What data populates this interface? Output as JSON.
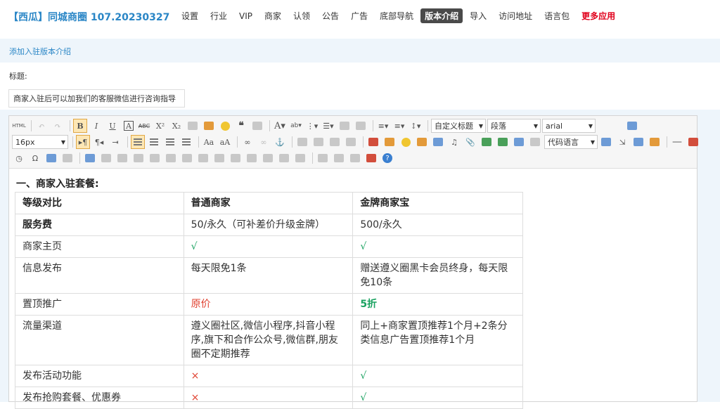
{
  "app": {
    "brand": "【西瓜】同城商圈 107.20230327"
  },
  "nav": {
    "items": [
      "设置",
      "行业",
      "VIP",
      "商家",
      "认领",
      "公告",
      "广告",
      "底部导航"
    ],
    "active": "版本介绍",
    "after": [
      "导入",
      "访问地址",
      "语言包"
    ],
    "more": "更多应用"
  },
  "section": {
    "title": "添加入驻版本介绍"
  },
  "form": {
    "title_label": "标题:",
    "title_value": "商家入驻后可以加我们的客服微信进行咨询指导"
  },
  "toolbar": {
    "custom_title": "自定义标题",
    "paragraph": "段落",
    "font": "arial",
    "font_size": "16px",
    "code_lang": "代码语言"
  },
  "content": {
    "heading": "一、商家入驻套餐:",
    "table": {
      "headers": [
        "等级对比",
        "普通商家",
        "金牌商家宝"
      ],
      "rows": [
        [
          "服务费",
          "50/永久（可补差价升级金牌）",
          "500/永久"
        ],
        [
          "商家主页",
          "√",
          "√"
        ],
        [
          "信息发布",
          "每天限免1条",
          "赠送遵义圈黑卡会员终身，每天限免10条"
        ],
        [
          "置顶推广",
          "原价",
          "5折"
        ],
        [
          "流量渠道",
          "遵义圈社区,微信小程序,抖音小程序,旗下和合作公众号,微信群,朋友圈不定期推荐",
          "同上+商家置顶推荐1个月+2条分类信息广告置顶推荐1个月"
        ],
        [
          "发布活动功能",
          "×",
          "√"
        ],
        [
          "发布抢购套餐、优惠券",
          "×",
          "√"
        ]
      ]
    }
  },
  "colors": {
    "accent": "#2a86c6",
    "check": "#1aa260",
    "cross": "#e0402f",
    "more": "#e0001b"
  }
}
